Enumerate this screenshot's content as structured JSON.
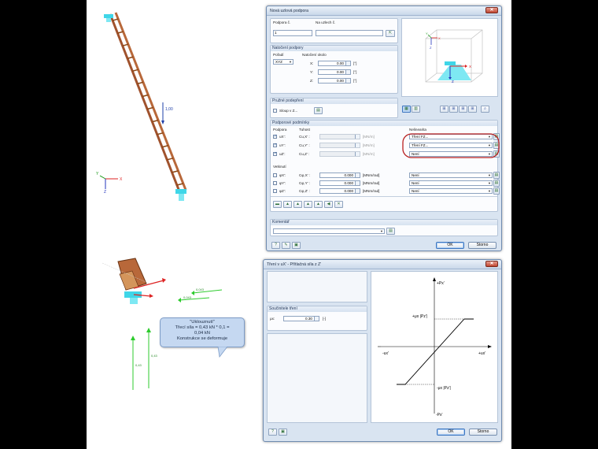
{
  "scene": {
    "load_top": "1,00",
    "force1": "0,043",
    "force2": "0,043",
    "side1": "0,43",
    "side2": "0,43",
    "axes1": {
      "x": "X",
      "y": "Y",
      "z": "Z"
    },
    "bubble_lines": [
      "\"Uklouznutí\"",
      "Třecí síla = 0,43 kN * 0,1 =",
      "0,04 kN",
      "Konstrukce se deformuje"
    ]
  },
  "dialog1": {
    "title": "Nová uzlová podpora",
    "close": "✕",
    "support_no_label": "Podpora č.",
    "support_no": "1",
    "nodes_label": "Na uzlech č.",
    "rotation_group": "Natočení podpory",
    "order_label": "Pořadí",
    "order_value": "XYZ",
    "rotation_label": "Natočení okolo",
    "rotation": [
      {
        "axis": "X:",
        "value": "0.00",
        "unit": "[°]"
      },
      {
        "axis": "Y:",
        "value": "0.00",
        "unit": "[°]"
      },
      {
        "axis": "Z:",
        "value": "0.00",
        "unit": "[°]"
      }
    ],
    "elastic_group": "Pružné podepření",
    "column_label": "Sloup v Z...",
    "conditions_group": "Podporové podmínky",
    "col_support": "Podpora",
    "col_stiffness": "Tuhost",
    "col_nonlinear": "Nelinearita",
    "trans_rows": [
      {
        "label": "uX':",
        "stiff": "Cu,X' :",
        "unit": "[MN/m]",
        "nonlin": "Tření FZ...",
        "checked": true
      },
      {
        "label": "uY':",
        "stiff": "Cu,Y' :",
        "unit": "[MN/m]",
        "nonlin": "Tření FZ...",
        "checked": true
      },
      {
        "label": "uZ':",
        "stiff": "Cu,Z' :",
        "unit": "[MN/m]",
        "nonlin": "Není",
        "checked": true
      }
    ],
    "rotation_sub": "Vetknutí",
    "rot_rows": [
      {
        "label": "φX':",
        "stiff": "Cφ,X' :",
        "value": "0.000",
        "unit": "[MNm/rad]",
        "nonlin": "Není"
      },
      {
        "label": "φY':",
        "stiff": "Cφ,Y' :",
        "value": "0.000",
        "unit": "[MNm/rad]",
        "nonlin": "Není"
      },
      {
        "label": "φZ':",
        "stiff": "Cφ,Z' :",
        "value": "0.000",
        "unit": "[MNm/rad]",
        "nonlin": "Není"
      }
    ],
    "comment_group": "Komentář",
    "ok": "OK",
    "cancel": "Storno",
    "preview_axes": {
      "x": "X",
      "y": "Y",
      "z": "Z"
    }
  },
  "dialog2": {
    "title": "Tření v uX' - Přítlačná síla z Z'",
    "close": "✕",
    "coef_group": "Součinitele tření",
    "mu_label": "μx:",
    "mu_value": "0.30",
    "mu_unit": "[-]",
    "ok": "OK",
    "cancel": "Storno",
    "graph": {
      "py": "+Px'",
      "ny": "-Px'",
      "px": "+ux'",
      "nx": "-ux'",
      "upper": "+μx |Pz'|",
      "lower": "-μx |Pz'|"
    }
  }
}
